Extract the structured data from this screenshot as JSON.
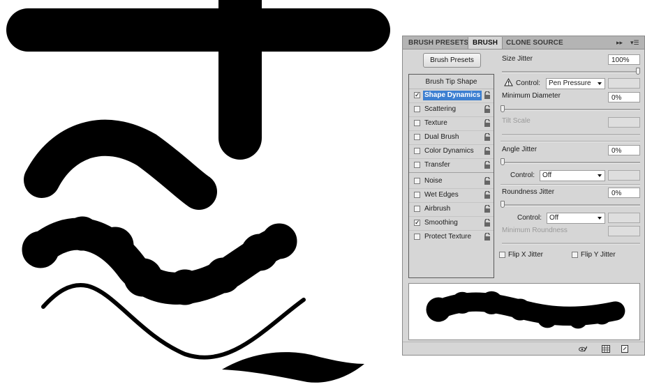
{
  "tabs": [
    {
      "label": "BRUSH PRESETS",
      "active": false
    },
    {
      "label": "BRUSH",
      "active": true
    },
    {
      "label": "CLONE SOURCE",
      "active": false
    }
  ],
  "tab_menu": {
    "collapse_icon": "double-chevron-right-icon",
    "menu_icon": "panel-menu-icon"
  },
  "brush_presets_button": "Brush Presets",
  "list": {
    "header": "Brush Tip Shape",
    "options": [
      {
        "label": "Shape Dynamics",
        "checked": true,
        "selected": true
      },
      {
        "label": "Scattering",
        "checked": false
      },
      {
        "label": "Texture",
        "checked": false
      },
      {
        "label": "Dual Brush",
        "checked": false
      },
      {
        "label": "Color Dynamics",
        "checked": false
      },
      {
        "label": "Transfer",
        "checked": false
      },
      {
        "label": "Noise",
        "checked": false
      },
      {
        "label": "Wet Edges",
        "checked": false
      },
      {
        "label": "Airbrush",
        "checked": false
      },
      {
        "label": "Smoothing",
        "checked": true
      },
      {
        "label": "Protect Texture",
        "checked": false
      }
    ]
  },
  "settings": {
    "size_jitter": {
      "label": "Size Jitter",
      "value": "100%",
      "slider_fraction": 1.0
    },
    "control1": {
      "label": "Control:",
      "value": "Pen Pressure"
    },
    "minimum_diameter": {
      "label": "Minimum Diameter",
      "value": "0%",
      "slider_fraction": 0.0
    },
    "tilt_scale": {
      "label": "Tilt Scale"
    },
    "angle_jitter": {
      "label": "Angle Jitter",
      "value": "0%",
      "slider_fraction": 0.0
    },
    "control2": {
      "label": "Control:",
      "value": "Off"
    },
    "roundness_jitter": {
      "label": "Roundness Jitter",
      "value": "0%",
      "slider_fraction": 0.0
    },
    "control3": {
      "label": "Control:",
      "value": "Off"
    },
    "minimum_roundness": {
      "label": "Minimum Roundness"
    },
    "flip_x": {
      "label": "Flip X Jitter",
      "checked": false
    },
    "flip_y": {
      "label": "Flip Y Jitter",
      "checked": false
    }
  },
  "footer_icons": [
    "eye-brush-icon",
    "grid-icon",
    "new-preset-icon"
  ],
  "colors": {
    "panel_bg": "#d6d6d6",
    "tab_bar": "#b4b4b4",
    "selection": "#3c7fd1",
    "brush_ink": "#000000",
    "canvas": "#ffffff"
  }
}
